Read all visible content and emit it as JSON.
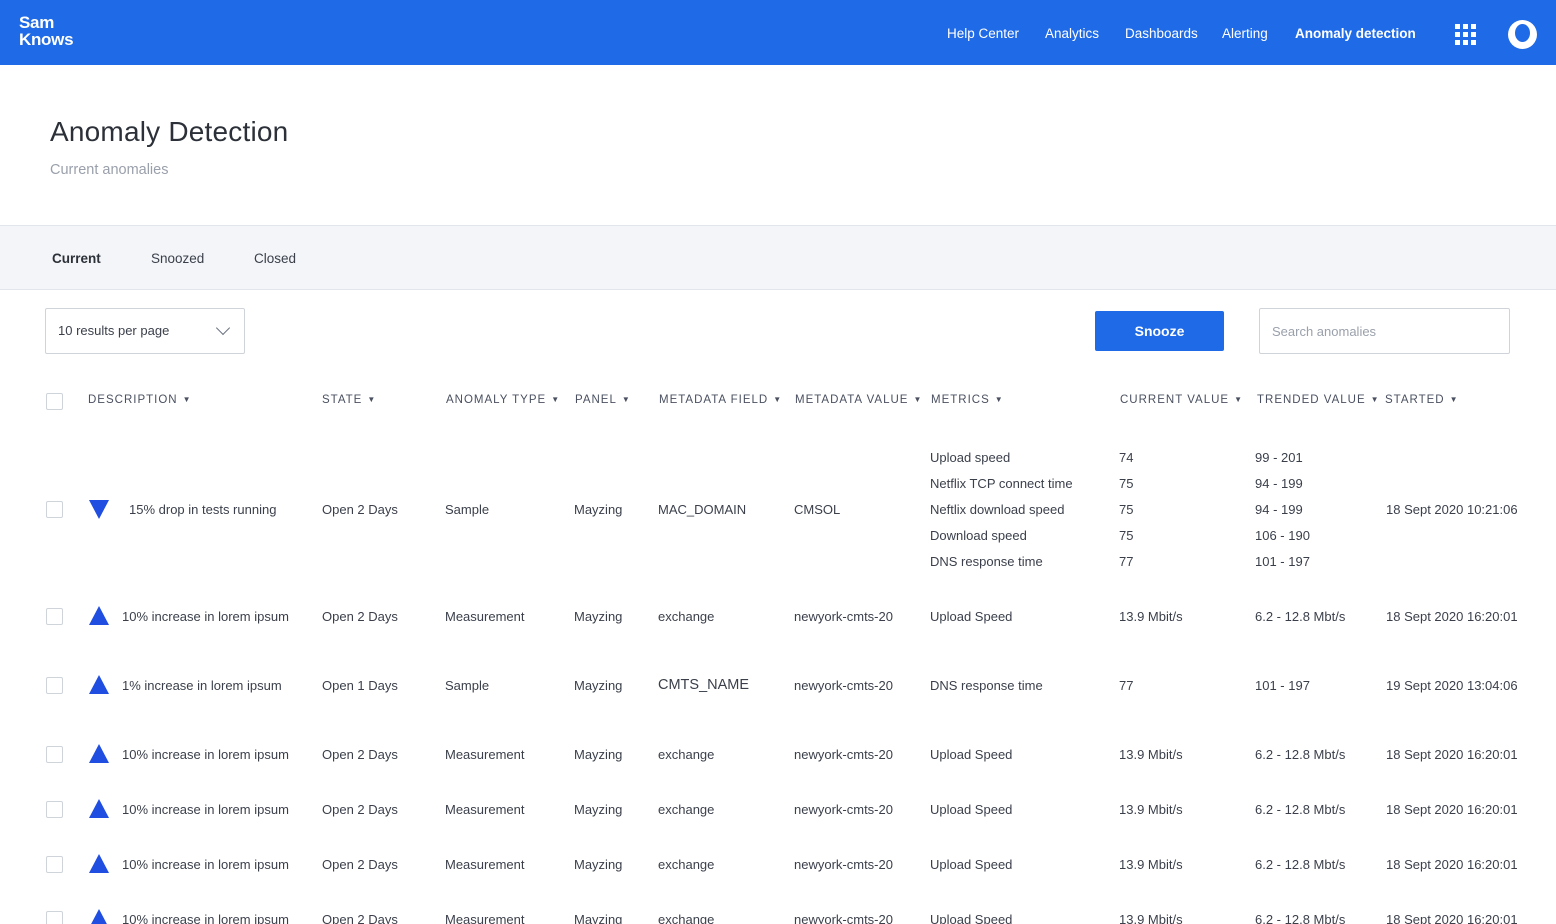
{
  "brand": {
    "line1": "Sam",
    "line2": "Knows"
  },
  "nav": {
    "help_center": "Help Center",
    "analytics": "Analytics",
    "dashboards": "Dashboards",
    "alerting": "Alerting",
    "anomaly_detection": "Anomaly detection"
  },
  "header": {
    "title": "Anomaly Detection",
    "subtitle": "Current anomalies"
  },
  "tabs": {
    "current": "Current",
    "snoozed": "Snoozed",
    "closed": "Closed"
  },
  "controls": {
    "per_page": "10 results per page",
    "snooze": "Snooze",
    "search_placeholder": "Search anomalies"
  },
  "columns": {
    "description": "DESCRIPTION",
    "state": "STATE",
    "anomaly_type": "ANOMALY TYPE",
    "panel": "PANEL",
    "metadata_field": "METADATA FIELD",
    "metadata_value": "METADATA VALUE",
    "metrics": "METRICS",
    "current_value": "CURRENT VALUE",
    "trended_value": "TRENDED VALUE",
    "started": "STARTED"
  },
  "row1": {
    "description": "15% drop in tests running",
    "state": "Open 2 Days",
    "type": "Sample",
    "panel": "Mayzing",
    "field": "MAC_DOMAIN",
    "value": "CMSOL",
    "started": "18 Sept 2020 10:21:06",
    "metrics": [
      {
        "name": "Upload speed",
        "current": "74",
        "trended": "99 - 201"
      },
      {
        "name": "Netflix TCP connect time",
        "current": "75",
        "trended": "94 - 199"
      },
      {
        "name": "Neftlix download speed",
        "current": "75",
        "trended": "94 - 199"
      },
      {
        "name": "Download speed",
        "current": "75",
        "trended": "106 - 190"
      },
      {
        "name": "DNS response time",
        "current": "77",
        "trended": "101 - 197"
      }
    ]
  },
  "rows": [
    {
      "description": "10% increase in lorem ipsum",
      "state": "Open 2 Days",
      "type": "Measurement",
      "panel": "Mayzing",
      "field": "exchange",
      "value": "newyork-cmts-20",
      "metric": "Upload Speed",
      "current": "13.9 Mbit/s",
      "trended": "6.2 - 12.8 Mbt/s",
      "started": "18 Sept 2020 16:20:01"
    },
    {
      "description": "1% increase in lorem ipsum",
      "state": "Open 1 Days",
      "type": "Sample",
      "panel": "Mayzing",
      "field": "CMTS_NAME",
      "value": "newyork-cmts-20",
      "metric": "DNS response time",
      "current": "77",
      "trended": "101 - 197",
      "started": "19 Sept 2020 13:04:06"
    },
    {
      "description": "10% increase in lorem ipsum",
      "state": "Open 2 Days",
      "type": "Measurement",
      "panel": "Mayzing",
      "field": "exchange",
      "value": "newyork-cmts-20",
      "metric": "Upload Speed",
      "current": "13.9 Mbit/s",
      "trended": "6.2 - 12.8 Mbt/s",
      "started": "18 Sept 2020 16:20:01"
    },
    {
      "description": "10% increase in lorem ipsum",
      "state": "Open 2 Days",
      "type": "Measurement",
      "panel": "Mayzing",
      "field": "exchange",
      "value": "newyork-cmts-20",
      "metric": "Upload Speed",
      "current": "13.9 Mbit/s",
      "trended": "6.2 - 12.8 Mbt/s",
      "started": "18 Sept 2020 16:20:01"
    },
    {
      "description": "10% increase in lorem ipsum",
      "state": "Open 2 Days",
      "type": "Measurement",
      "panel": "Mayzing",
      "field": "exchange",
      "value": "newyork-cmts-20",
      "metric": "Upload Speed",
      "current": "13.9 Mbit/s",
      "trended": "6.2 - 12.8 Mbt/s",
      "started": "18 Sept 2020 16:20:01"
    },
    {
      "description": "10% increase in lorem ipsum",
      "state": "Open 2 Days",
      "type": "Measurement",
      "panel": "Mayzing",
      "field": "exchange",
      "value": "newyork-cmts-20",
      "metric": "Upload Speed",
      "current": "13.9 Mbit/s",
      "trended": "6.2 - 12.8 Mbt/s",
      "started": "18 Sept 2020 16:20:01"
    }
  ]
}
